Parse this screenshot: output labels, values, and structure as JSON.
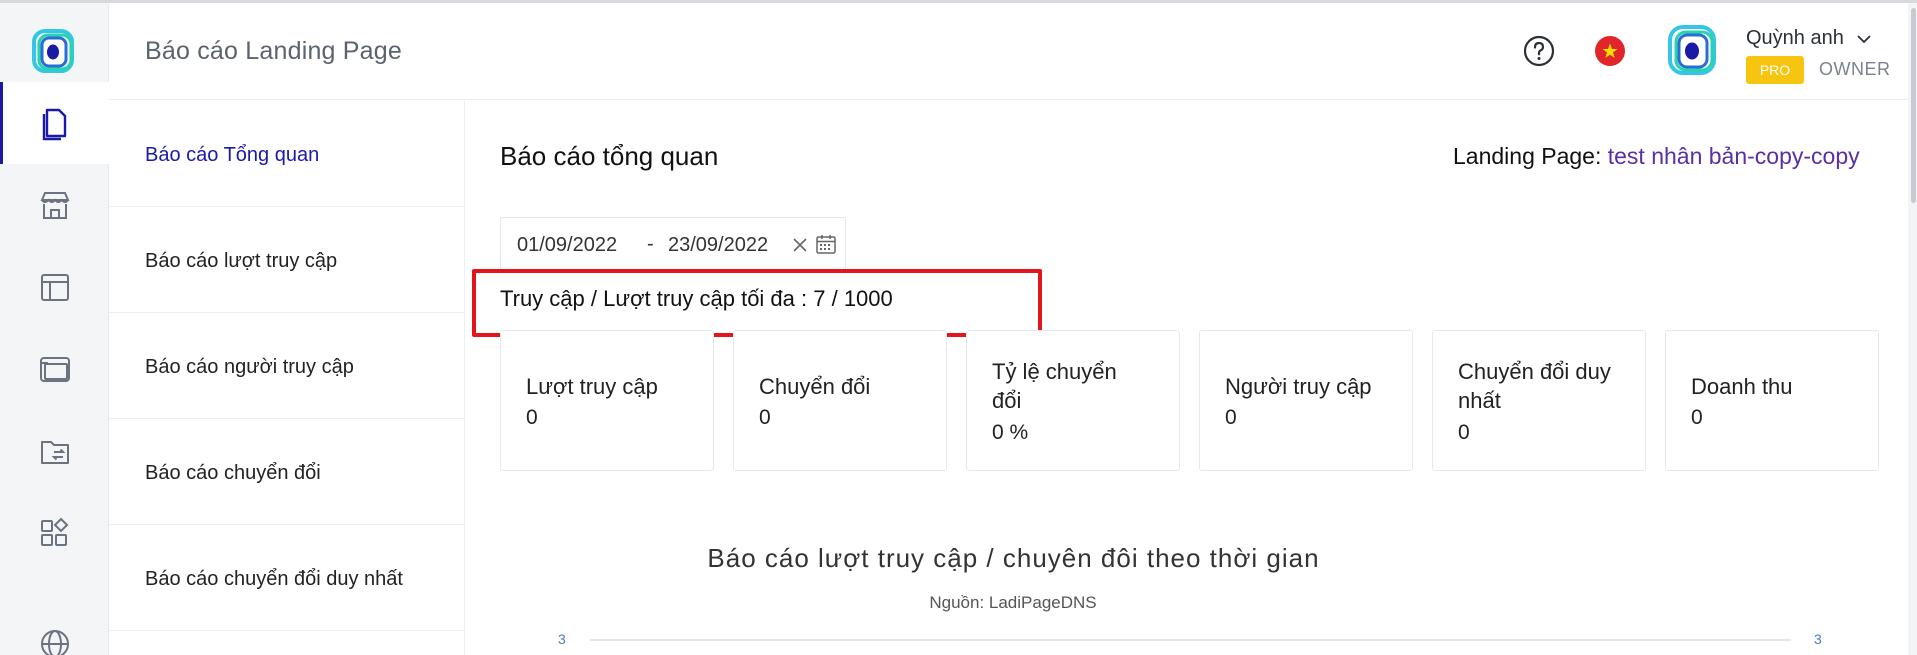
{
  "header": {
    "title": "Báo cáo Landing Page",
    "user_name": "Quỳnh anh",
    "plan_badge": "PRO",
    "role": "OWNER"
  },
  "rail": {
    "icons": [
      "pages-icon",
      "store-icon",
      "layout-icon",
      "browser-icon",
      "folder-transfer-icon",
      "apps-icon",
      "globe-icon"
    ],
    "active_index": 0
  },
  "submenu": {
    "items": [
      {
        "label": "Báo cáo Tổng quan",
        "active": true
      },
      {
        "label": "Báo cáo lượt truy cập",
        "active": false
      },
      {
        "label": "Báo cáo người truy cập",
        "active": false
      },
      {
        "label": "Báo cáo chuyển đổi",
        "active": false
      },
      {
        "label": "Báo cáo chuyển đổi duy nhất",
        "active": false
      }
    ]
  },
  "main": {
    "title": "Báo cáo tổng quan",
    "landing_page_label": "Landing Page:",
    "landing_page_value": "test nhân bản-copy-copy",
    "date_from": "01/09/2022",
    "date_separator": "-",
    "date_to": "23/09/2022",
    "quota_text": "Truy cập / Lượt truy cập tối đa : 7 / 1000",
    "cards": [
      {
        "label": "Lượt truy cập",
        "value": "0"
      },
      {
        "label": "Chuyển đổi",
        "value": "0"
      },
      {
        "label": "Tỷ lệ chuyển đổi",
        "value": "0 %"
      },
      {
        "label": "Người truy cập",
        "value": "0"
      },
      {
        "label": "Chuyển đổi duy nhất",
        "value": "0"
      },
      {
        "label": "Doanh thu",
        "value": "0"
      }
    ]
  },
  "chart": {
    "title": "Báo cáo lượt truy cập / chuyên đôi theo thời gian",
    "source": "Nguồn: LadiPageDNS",
    "y_left_top": "3",
    "y_right_top": "3"
  },
  "colors": {
    "accent": "#1a1aa6",
    "highlight": "#e4141b",
    "badge": "#f7c510",
    "link": "#5a2fa5"
  }
}
